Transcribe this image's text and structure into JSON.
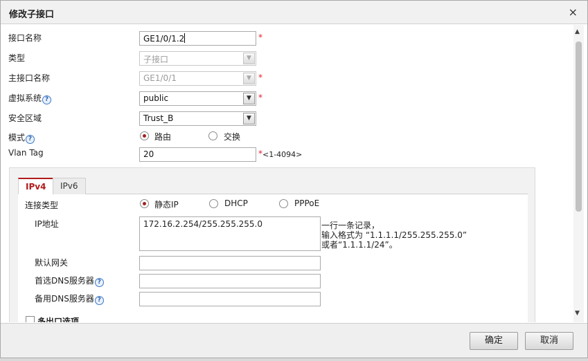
{
  "dialog": {
    "title": "修改子接口",
    "close_glyph": "×"
  },
  "form": {
    "interface_name": {
      "label": "接口名称",
      "value": "GE1/0/1.2",
      "required": "*"
    },
    "type": {
      "label": "类型",
      "value": "子接口"
    },
    "main_interface": {
      "label": "主接口名称",
      "value": "GE1/0/1",
      "required": "*"
    },
    "virtual_system": {
      "label": "虚拟系统",
      "help": "?",
      "value": "public",
      "required": "*"
    },
    "security_zone": {
      "label": "安全区域",
      "value": "Trust_B"
    },
    "mode": {
      "label": "模式",
      "help": "?",
      "options": [
        "路由",
        "交换"
      ],
      "selected": "路由"
    },
    "vlan_tag": {
      "label": "Vlan Tag",
      "value": "20",
      "required": "*",
      "range": "<1-4094>"
    }
  },
  "tabs": [
    {
      "label": "IPv4",
      "active": true
    },
    {
      "label": "IPv6",
      "active": false
    }
  ],
  "ipv4": {
    "connection_type": {
      "label": "连接类型",
      "options": [
        "静态IP",
        "DHCP",
        "PPPoE"
      ],
      "selected": "静态IP"
    },
    "ip_address": {
      "label": "IP地址",
      "value": "172.16.2.254/255.255.255.0",
      "hint_lines": [
        "一行一条记录，",
        "输入格式为 “1.1.1.1/255.255.255.0”",
        "或者“1.1.1.1/24”。"
      ]
    },
    "default_gateway": {
      "label": "默认网关",
      "value": ""
    },
    "primary_dns": {
      "label": "首选DNS服务器",
      "help": "?",
      "value": ""
    },
    "backup_dns": {
      "label": "备用DNS服务器",
      "help": "?",
      "value": ""
    },
    "multi_egress": {
      "label": "多出口选项",
      "checked": false
    }
  },
  "footer": {
    "ok_label": "确定",
    "cancel_label": "取消"
  },
  "colors": {
    "accent": "#b11a1a",
    "required": "#e0212a",
    "help": "#2a62b0"
  }
}
